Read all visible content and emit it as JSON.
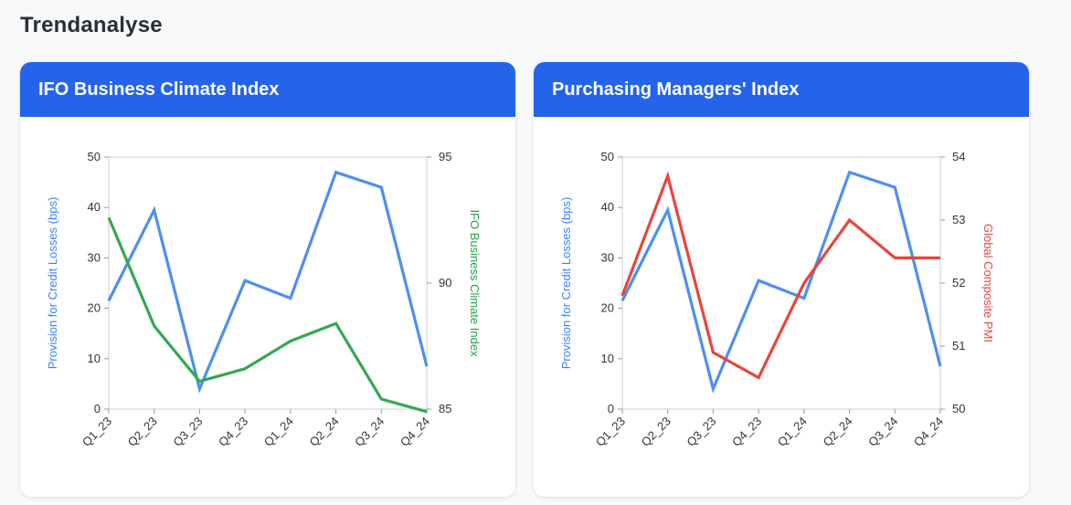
{
  "page": {
    "title": "Trendanalyse"
  },
  "cards": [
    {
      "title": "IFO Business Climate Index"
    },
    {
      "title": "Purchasing Managers' Index"
    }
  ],
  "chart_data": [
    {
      "type": "line",
      "title": "IFO Business Climate Index",
      "categories": [
        "Q1_23",
        "Q2_23",
        "Q3_23",
        "Q4_23",
        "Q1_24",
        "Q2_24",
        "Q3_24",
        "Q4_24"
      ],
      "left_axis": {
        "label": "Provision for Credit Losses (bps)",
        "ylim": [
          0,
          50
        ],
        "ticks": [
          0,
          10,
          20,
          30,
          40,
          50
        ],
        "color": "#3b82f6"
      },
      "right_axis": {
        "label": "IFO Business Climate Index",
        "ylim": [
          85,
          95
        ],
        "ticks": [
          85,
          90,
          95
        ],
        "color": "#22a34a"
      },
      "grid": false,
      "series": [
        {
          "axis": "left",
          "color": "#4d8ff0",
          "values": [
            21.5,
            39.5,
            4,
            25.5,
            22,
            47,
            44,
            8.5
          ]
        },
        {
          "axis": "right",
          "color": "#34a853",
          "values": [
            92.6,
            88.3,
            86.1,
            86.6,
            87.7,
            88.4,
            85.4,
            84.9
          ]
        }
      ]
    },
    {
      "type": "line",
      "title": "Purchasing Managers' Index",
      "categories": [
        "Q1_23",
        "Q2_23",
        "Q3_23",
        "Q4_23",
        "Q1_24",
        "Q2_24",
        "Q3_24",
        "Q4_24"
      ],
      "left_axis": {
        "label": "Provision for Credit Losses (bps)",
        "ylim": [
          0,
          50
        ],
        "ticks": [
          0,
          10,
          20,
          30,
          40,
          50
        ],
        "color": "#3b82f6"
      },
      "right_axis": {
        "label": "Global Composite PMI",
        "ylim": [
          50,
          54
        ],
        "ticks": [
          50,
          51,
          52,
          53,
          54
        ],
        "color": "#e8453c"
      },
      "grid": false,
      "series": [
        {
          "axis": "left",
          "color": "#4d8ff0",
          "values": [
            21.5,
            39.5,
            4,
            25.5,
            22,
            47,
            44,
            8.5
          ]
        },
        {
          "axis": "right",
          "color": "#e8453c",
          "values": [
            51.8,
            53.7,
            50.9,
            50.5,
            52.0,
            53.0,
            52.4,
            52.4
          ]
        }
      ]
    }
  ]
}
